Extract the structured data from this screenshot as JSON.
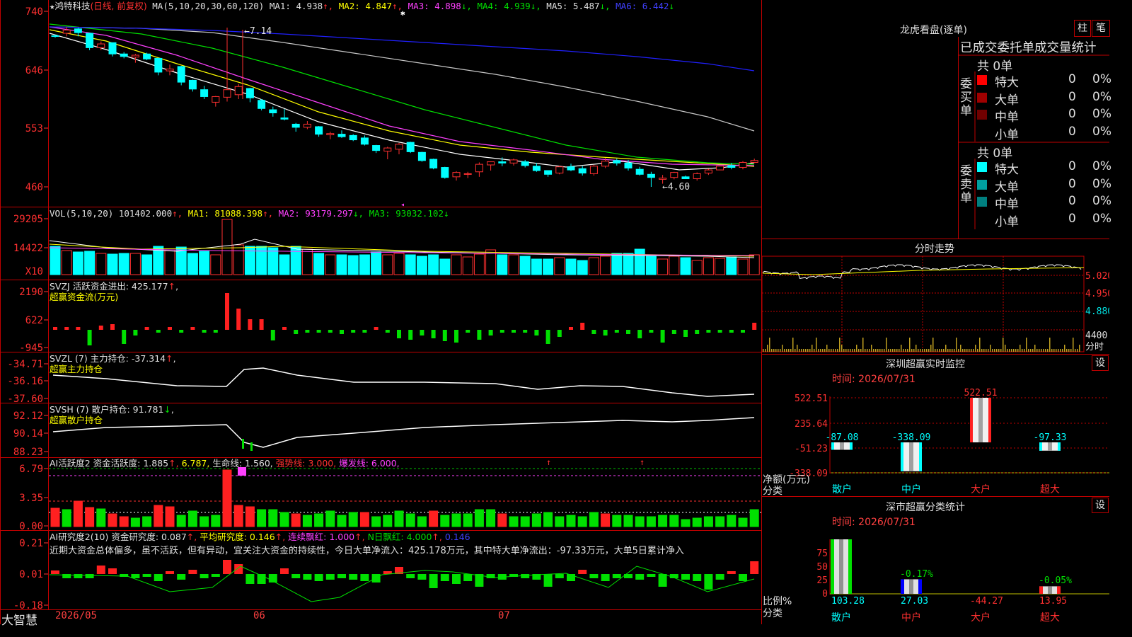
{
  "stock": {
    "name": "鸿特科技",
    "period": "(日线, 前复权)",
    "star": "★"
  },
  "header_main": {
    "params": "MA(5,10,20,30,60,120)",
    "ma1": "MA1: 4.938",
    "ma2": "MA2: 4.847",
    "ma3": "MA3: 4.898",
    "ma4": "MA4: 4.939",
    "ma5": "MA5: 5.487",
    "ma6": "MA6: 6.442"
  },
  "header_vol": {
    "params": "VOL(5,10,20)",
    "vol": "101402.000",
    "ma1": "MA1: 81088.398",
    "ma2": "MA2: 93179.297",
    "ma3": "MA3: 93032.102"
  },
  "header_svzj": {
    "line1": "SVZJ  活跃资金进出: 425.177",
    "line2": "超赢资金流(万元)"
  },
  "header_svzl": {
    "line1": "SVZL (7) 主力持仓: -37.314",
    "line2": "超赢主力持仓"
  },
  "header_svsh": {
    "line1": "SVSH (7) 散户持仓: 91.781",
    "line2": "超赢散户持仓"
  },
  "header_ai1": {
    "a": "AI活跃度2 资金活跃度: 1.885",
    "b": "6.787,",
    "c": "生命线: 1.560,",
    "d": "强势线: 3.000,",
    "e": "爆发线: 6.000,"
  },
  "header_ai2": {
    "a": "AI研究度2(10) 资金研究度: 0.087",
    "b": "平均研究度: 0.146",
    "c": "连续飘红: 1.000",
    "d": "N日飘红: 4.000",
    "e": "0.146"
  },
  "ai_text": "近期大资金总体偏多，虽不活跃，但有异动，宜关注大资金的持续性，今日大单净流入：425.178万元，其中特大单净流出：-97.33万元，大单5日累计净入",
  "axes": {
    "price": [
      "740",
      "646",
      "553",
      "460"
    ],
    "vol": [
      "29205",
      "14422",
      "X10"
    ],
    "svzj": [
      "2190",
      "622",
      "-945"
    ],
    "svzl": [
      "-34.71",
      "-36.16",
      "-37.60"
    ],
    "svsh": [
      "92.12",
      "90.14",
      "88.23"
    ],
    "ai1": [
      "6.79",
      "3.35",
      "0.00"
    ],
    "ai2": [
      "0.21",
      "0.01",
      "-0.18"
    ]
  },
  "annotations": {
    "high": "7.14",
    "low": "4.60"
  },
  "dates": [
    "2026/05",
    "06",
    "07"
  ],
  "brand": "大智慧",
  "right": {
    "lh_title": "龙虎看盘(逐单)",
    "lh_buttons": [
      "柱",
      "笔"
    ],
    "lh_header": "已成交委托单成交量统计",
    "buy_total": "共 0单",
    "sell_total": "共 0单",
    "buy_side": "委买单",
    "sell_side": "委卖单",
    "buy_rows": [
      {
        "label": "特大",
        "val": "0",
        "pct": "0%",
        "color": "#ff0000"
      },
      {
        "label": "大单",
        "val": "0",
        "pct": "0%",
        "color": "#a00000"
      },
      {
        "label": "中单",
        "val": "0",
        "pct": "0%",
        "color": "#700000"
      },
      {
        "label": "小单",
        "val": "0",
        "pct": "0%",
        "color": "#000000"
      }
    ],
    "sell_rows": [
      {
        "label": "特大",
        "val": "0",
        "pct": "0%",
        "color": "#00ffff"
      },
      {
        "label": "大单",
        "val": "0",
        "pct": "0%",
        "color": "#00a0a0"
      },
      {
        "label": "中单",
        "val": "0",
        "pct": "0%",
        "color": "#008080"
      },
      {
        "label": "小单",
        "val": "0",
        "pct": "0%",
        "color": "#000000"
      }
    ],
    "fs_title": "分时走势",
    "fs_axis": [
      "5.020",
      "4.950",
      "4.880",
      "4400",
      "分时"
    ],
    "sz_title": "深圳超赢实时监控",
    "sz_btn": "设",
    "sz_time": "时间: 2026/07/31",
    "sz_axis": [
      "522.51",
      "235.64",
      "-51.23",
      "-338.09"
    ],
    "sz_unit": "净额(万元)",
    "sz_cat": "分类",
    "sz_cats": [
      "散户",
      "中户",
      "大户",
      "超大"
    ],
    "sz_vals": [
      "-87.08",
      "-338.09",
      "522.51",
      "-97.33"
    ],
    "sc_title": "深市超赢分类统计",
    "sc_btn": "设",
    "sc_time": "时间: 2026/07/31",
    "sc_axis": [
      "75",
      "50",
      "25",
      "0"
    ],
    "sc_unit": "比例%",
    "sc_cat": "分类",
    "sc_cats": [
      "散户",
      "中户",
      "大户",
      "超大"
    ],
    "sc_vals": [
      "103.28",
      "27.03",
      "-44.27",
      "13.95"
    ],
    "sc_top": [
      "-0.17%",
      "-0.05%"
    ]
  },
  "chart_data": [
    {
      "type": "candlestick",
      "title": "鸿特科技 (日线, 前复权)",
      "ylim": [
        4.6,
        7.4
      ],
      "ohlc": [
        [
          7.01,
          7.03,
          6.98,
          7.0
        ],
        [
          7.05,
          7.15,
          7.0,
          7.1
        ],
        [
          7.12,
          7.14,
          7.0,
          7.06
        ],
        [
          7.05,
          7.06,
          6.78,
          6.82
        ],
        [
          6.82,
          6.92,
          6.78,
          6.88
        ],
        [
          6.9,
          6.9,
          6.68,
          6.72
        ],
        [
          6.72,
          6.75,
          6.65,
          6.68
        ],
        [
          6.67,
          6.72,
          6.58,
          6.7
        ],
        [
          6.72,
          6.74,
          6.62,
          6.64
        ],
        [
          6.65,
          6.66,
          6.38,
          6.43
        ],
        [
          6.45,
          6.55,
          6.38,
          6.48
        ],
        [
          6.52,
          6.53,
          6.22,
          6.27
        ],
        [
          6.3,
          6.31,
          6.12,
          6.16
        ],
        [
          6.15,
          6.21,
          6.0,
          6.04
        ],
        [
          5.95,
          6.05,
          5.88,
          6.04
        ],
        [
          6.03,
          7.14,
          5.96,
          6.15
        ],
        [
          6.07,
          6.24,
          6.0,
          6.2
        ],
        [
          6.17,
          6.18,
          5.95,
          6.02
        ],
        [
          5.98,
          6.0,
          5.82,
          5.85
        ],
        [
          5.83,
          5.88,
          5.72,
          5.78
        ],
        [
          5.7,
          5.84,
          5.66,
          5.68
        ],
        [
          5.6,
          5.62,
          5.48,
          5.55
        ],
        [
          5.55,
          5.65,
          5.52,
          5.6
        ],
        [
          5.56,
          5.57,
          5.4,
          5.44
        ],
        [
          5.43,
          5.48,
          5.36,
          5.45
        ],
        [
          5.44,
          5.5,
          5.38,
          5.4
        ],
        [
          5.42,
          5.44,
          5.33,
          5.35
        ],
        [
          5.38,
          5.42,
          5.26,
          5.28
        ],
        [
          5.26,
          5.27,
          5.14,
          5.18
        ],
        [
          5.17,
          5.24,
          5.04,
          5.22
        ],
        [
          5.2,
          5.3,
          5.12,
          5.28
        ],
        [
          5.31,
          5.32,
          5.14,
          5.16
        ],
        [
          5.15,
          5.16,
          5.0,
          5.02
        ],
        [
          5.04,
          5.05,
          4.88,
          4.9
        ],
        [
          4.91,
          4.92,
          4.73,
          4.75
        ],
        [
          4.76,
          4.85,
          4.7,
          4.83
        ],
        [
          4.8,
          4.84,
          4.74,
          4.81
        ],
        [
          4.84,
          4.99,
          4.76,
          4.96
        ],
        [
          4.95,
          5.0,
          4.86,
          5.0
        ],
        [
          5.0,
          5.07,
          4.93,
          4.98
        ],
        [
          4.98,
          5.05,
          4.94,
          5.03
        ],
        [
          5.0,
          5.03,
          4.91,
          4.94
        ],
        [
          4.93,
          4.98,
          4.84,
          4.86
        ],
        [
          4.86,
          4.86,
          4.76,
          4.8
        ],
        [
          4.82,
          4.94,
          4.8,
          4.92
        ],
        [
          4.92,
          4.97,
          4.85,
          4.87
        ],
        [
          4.89,
          4.93,
          4.78,
          4.82
        ],
        [
          4.81,
          4.95,
          4.78,
          4.93
        ],
        [
          4.93,
          5.06,
          4.9,
          5.01
        ],
        [
          5.02,
          5.05,
          4.94,
          4.98
        ],
        [
          4.98,
          5.03,
          4.86,
          4.9
        ],
        [
          4.88,
          4.92,
          4.78,
          4.8
        ],
        [
          4.8,
          4.84,
          4.6,
          4.75
        ],
        [
          4.72,
          4.79,
          4.65,
          4.74
        ],
        [
          4.75,
          4.84,
          4.72,
          4.83
        ],
        [
          4.76,
          4.78,
          4.73,
          4.73
        ],
        [
          4.73,
          4.83,
          4.7,
          4.81
        ],
        [
          4.82,
          4.89,
          4.79,
          4.87
        ],
        [
          4.87,
          4.93,
          4.87,
          4.93
        ],
        [
          4.94,
          4.98,
          4.88,
          4.91
        ],
        [
          4.91,
          5.01,
          4.88,
          4.99
        ],
        [
          4.99,
          5.05,
          4.98,
          5.02
        ]
      ]
    },
    {
      "type": "bar",
      "title": "VOL(5,10,20)",
      "ylim": [
        0,
        29205
      ]
    },
    {
      "type": "bar",
      "title": "SVZJ 活跃资金进出",
      "ylim": [
        -945,
        2190
      ]
    },
    {
      "type": "line",
      "title": "SVZL (7) 主力持仓",
      "ylim": [
        -37.6,
        -34.71
      ]
    },
    {
      "type": "line",
      "title": "SVSH (7) 散户持仓",
      "ylim": [
        88.23,
        92.12
      ]
    },
    {
      "type": "bar",
      "title": "AI活跃度2",
      "ylim": [
        0,
        6.79
      ]
    },
    {
      "type": "bar",
      "title": "AI研究度2(10)",
      "ylim": [
        -0.18,
        0.21
      ]
    },
    {
      "type": "bar",
      "title": "深圳超赢实时监控",
      "categories": [
        "散户",
        "中户",
        "大户",
        "超大"
      ],
      "values": [
        -87.08,
        -338.09,
        522.51,
        -97.33
      ]
    },
    {
      "type": "bar",
      "title": "深市超赢分类统计",
      "categories": [
        "散户",
        "中户",
        "大户",
        "超大"
      ],
      "values": [
        103.28,
        27.03,
        -44.27,
        13.95
      ]
    }
  ]
}
